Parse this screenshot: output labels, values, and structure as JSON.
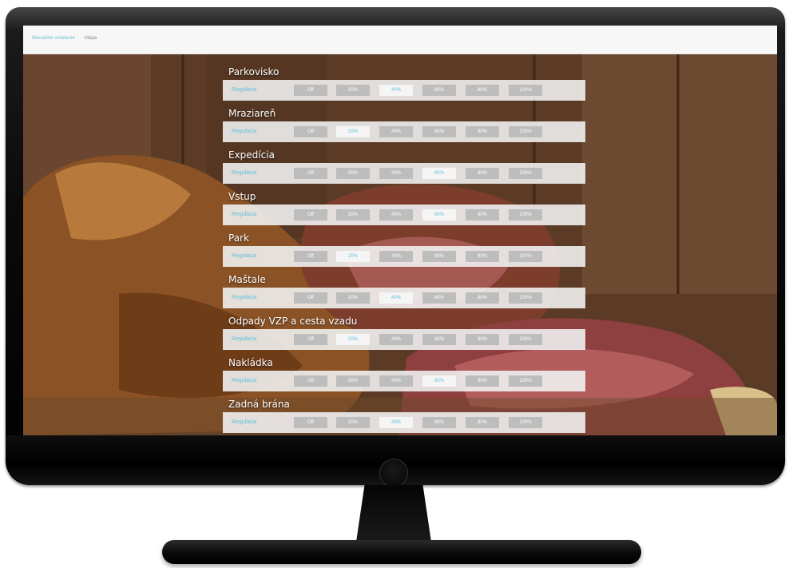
{
  "nav": {
    "manual_label": "Manuálne ovládanie",
    "map_label": "Mapa"
  },
  "buttons": [
    "Off",
    "20%",
    "40%",
    "60%",
    "80%",
    "100%"
  ],
  "regulation_label": "Regulácia",
  "zones": [
    {
      "name": "Parkovisko",
      "selected": "40%"
    },
    {
      "name": "Mraziareň",
      "selected": "20%"
    },
    {
      "name": "Expedícia",
      "selected": "60%"
    },
    {
      "name": "Vstup",
      "selected": "60%"
    },
    {
      "name": "Park",
      "selected": "20%"
    },
    {
      "name": "Maštale",
      "selected": "40%"
    },
    {
      "name": "Odpady VZP a cesta vzadu",
      "selected": "20%"
    },
    {
      "name": "Nakládka",
      "selected": "60%"
    },
    {
      "name": "Zadná brána",
      "selected": "40%"
    }
  ],
  "colors": {
    "accent": "#5fc0d8",
    "button_bg": "#bdbdbd",
    "bar_bg": "#f0f0f0"
  }
}
